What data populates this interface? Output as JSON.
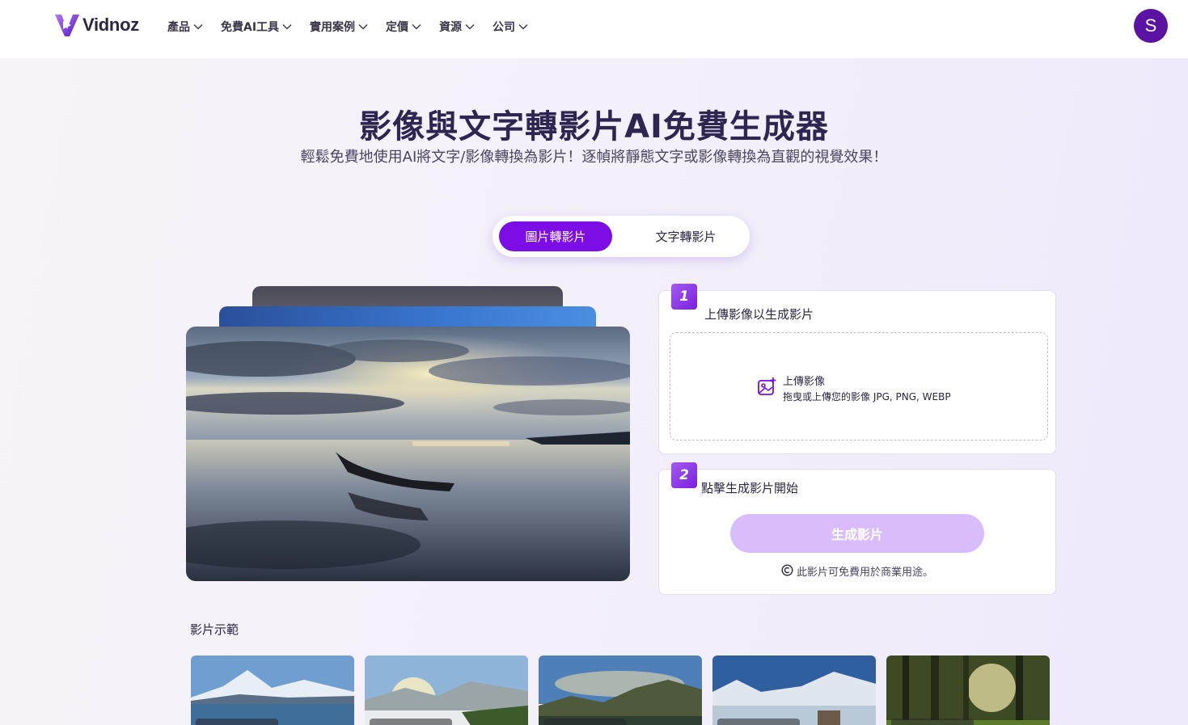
{
  "brand": {
    "name": "Vidnoz",
    "accent": "#7c0de6",
    "accent_light": "#d8bdfa"
  },
  "nav": {
    "items": [
      {
        "label": "產品"
      },
      {
        "label": "免費AI工具"
      },
      {
        "label": "實用案例"
      },
      {
        "label": "定價"
      },
      {
        "label": "資源"
      },
      {
        "label": "公司"
      }
    ]
  },
  "user": {
    "avatar_letter": "S"
  },
  "hero": {
    "title": "影像與文字轉影片AI免費生成器",
    "subtitle": "輕鬆免費地使用AI將文字/影像轉換為影片！逐幀將靜態文字或影像轉換為直觀的視覺效果！"
  },
  "tabs": [
    {
      "label": "圖片轉影片",
      "active": true
    },
    {
      "label": "文字轉影片",
      "active": false
    }
  ],
  "step1": {
    "number": "1",
    "title": "上傳影像以生成影片",
    "upload_title": "上傳影像",
    "upload_hint": "拖曳或上傳您的影像 JPG, PNG, WEBP"
  },
  "step2": {
    "number": "2",
    "title": "點擊生成影片開始",
    "button_label": "生成影片",
    "note": "此影片可免費用於商業用途。"
  },
  "samples": {
    "title": "影片示範",
    "items": [
      {
        "icon": "mountain-lake-thumbnail"
      },
      {
        "icon": "misty-valley-thumbnail"
      },
      {
        "icon": "alpine-lake-thumbnail"
      },
      {
        "icon": "snowy-valley-thumbnail"
      },
      {
        "icon": "forest-thumbnail"
      }
    ]
  }
}
